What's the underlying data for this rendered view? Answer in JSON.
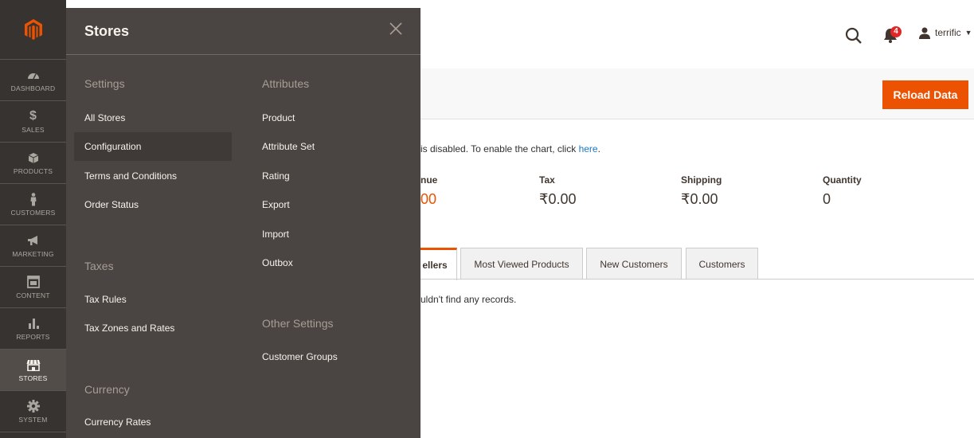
{
  "header": {
    "user_name": "terrific",
    "notification_count": "4"
  },
  "page": {
    "reload_label": "Reload Data",
    "chart_message": "is disabled. To enable the chart, click ",
    "chart_link": "here",
    "chart_message_end": ".",
    "totals": [
      {
        "label": "nue",
        "value": "00"
      },
      {
        "label": "Tax",
        "value": "₹0.00"
      },
      {
        "label": "Shipping",
        "value": "₹0.00"
      },
      {
        "label": "Quantity",
        "value": "0"
      }
    ],
    "tabs": [
      "ellers",
      "Most Viewed Products",
      "New Customers",
      "Customers"
    ],
    "empty_message": "uldn't find any records."
  },
  "admin_menu": {
    "items": [
      {
        "label": "DASHBOARD",
        "icon": "dashboard-icon"
      },
      {
        "label": "SALES",
        "icon": "dollar-icon"
      },
      {
        "label": "PRODUCTS",
        "icon": "box-icon"
      },
      {
        "label": "CUSTOMERS",
        "icon": "person-icon"
      },
      {
        "label": "MARKETING",
        "icon": "megaphone-icon"
      },
      {
        "label": "CONTENT",
        "icon": "layout-icon"
      },
      {
        "label": "REPORTS",
        "icon": "bar-chart-icon"
      },
      {
        "label": "STORES",
        "icon": "store-icon"
      },
      {
        "label": "SYSTEM",
        "icon": "gear-icon"
      }
    ]
  },
  "flyout": {
    "title": "Stores",
    "settings": {
      "title": "Settings",
      "links": [
        "All Stores",
        "Configuration",
        "Terms and Conditions",
        "Order Status"
      ]
    },
    "taxes": {
      "title": "Taxes",
      "links": [
        "Tax Rules",
        "Tax Zones and Rates"
      ]
    },
    "currency": {
      "title": "Currency",
      "links": [
        "Currency Rates"
      ]
    },
    "attributes": {
      "title": "Attributes",
      "links": [
        "Product",
        "Attribute Set",
        "Rating",
        "Export",
        "Import",
        "Outbox"
      ]
    },
    "other_settings": {
      "title": "Other Settings",
      "links": [
        "Customer Groups"
      ]
    }
  },
  "colors": {
    "accent": "#eb5202",
    "menu_bg": "#373330",
    "flyout_bg": "#4a4542",
    "link": "#1979c3"
  }
}
